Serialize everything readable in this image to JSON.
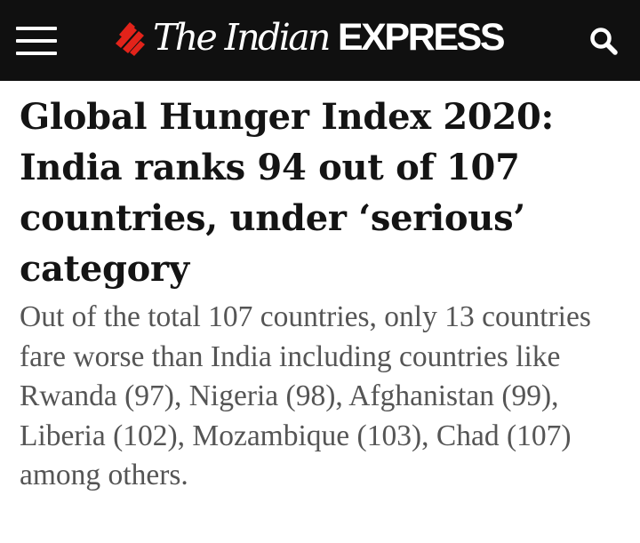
{
  "header": {
    "logo_text_serif": "The Indian",
    "logo_text_sans": "EXPRESS",
    "menu_icon": "hamburger-menu-icon",
    "search_icon": "search-icon",
    "background_color": "#101010",
    "brand_red": "#e2231a"
  },
  "article": {
    "headline": "Global Hunger Index 2020: India ranks 94 out of 107 countries, under ‘serious’ category",
    "summary": "Out of the total 107 countries, only 13 countries fare worse than India including countries like Rwanda (97), Nigeria (98), Afghanistan (99), Liberia (102), Mozambique (103), Chad (107) among others."
  }
}
